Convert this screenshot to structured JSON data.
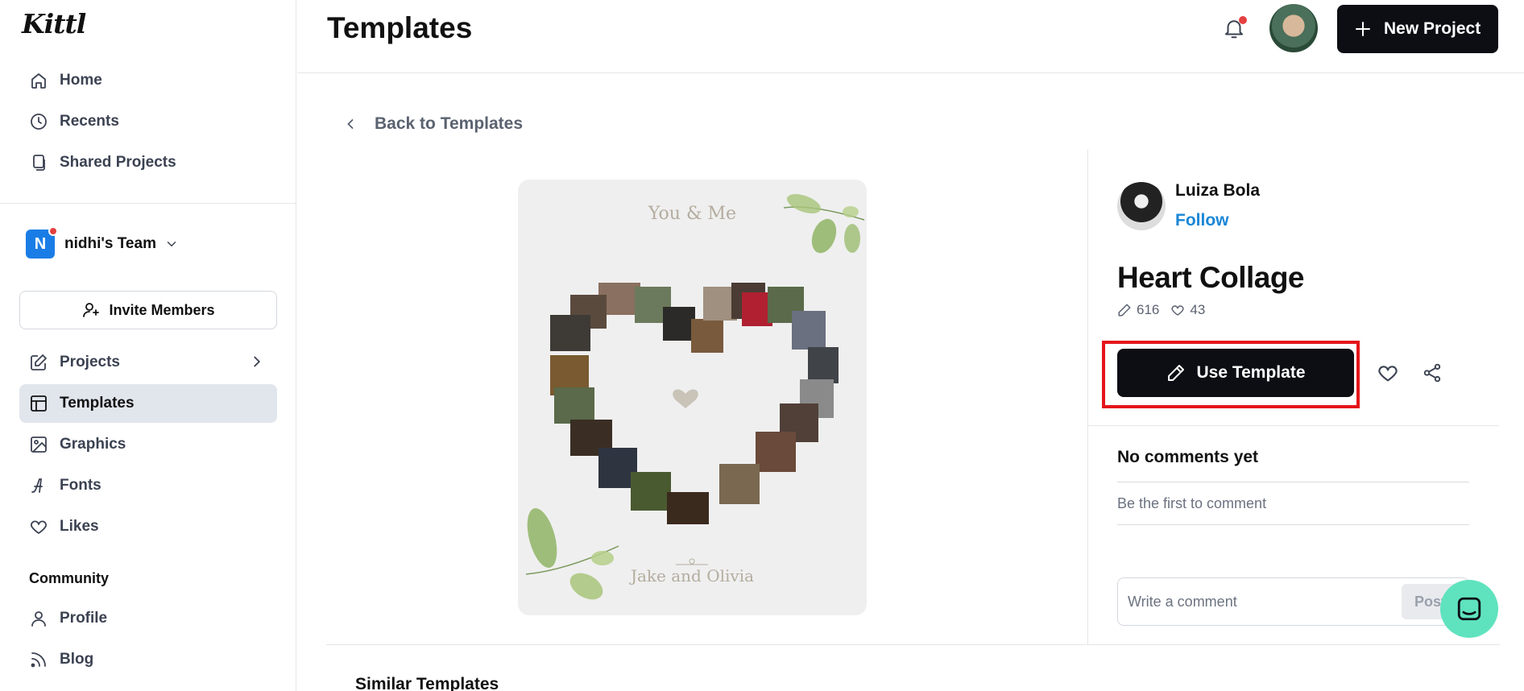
{
  "app": {
    "logo": "Kittl"
  },
  "sidebar": {
    "nav": [
      {
        "label": "Home",
        "icon": "home-icon"
      },
      {
        "label": "Recents",
        "icon": "clock-icon"
      },
      {
        "label": "Shared Projects",
        "icon": "shared-files-icon"
      }
    ],
    "team": {
      "initial": "N",
      "name": "nidhi's Team"
    },
    "invite_label": "Invite Members",
    "workspace": [
      {
        "label": "Projects",
        "icon": "pencil-square-icon"
      },
      {
        "label": "Templates",
        "icon": "layout-icon",
        "active": true
      },
      {
        "label": "Graphics",
        "icon": "image-icon"
      },
      {
        "label": "Fonts",
        "icon": "font-icon"
      },
      {
        "label": "Likes",
        "icon": "heart-icon"
      }
    ],
    "community_label": "Community",
    "community": [
      {
        "label": "Profile",
        "icon": "user-icon"
      },
      {
        "label": "Blog",
        "icon": "rss-icon"
      }
    ]
  },
  "header": {
    "title": "Templates",
    "new_project_label": "New Project"
  },
  "main": {
    "back_label": "Back to Templates",
    "preview": {
      "title": "You & Me",
      "names": "Jake and Olivia"
    },
    "similar_label": "Similar Templates"
  },
  "template": {
    "author": "Luiza Bola",
    "follow_label": "Follow",
    "title": "Heart Collage",
    "uses": "616",
    "likes": "43",
    "use_label": "Use Template"
  },
  "comments": {
    "empty_title": "No comments yet",
    "empty_subtitle": "Be the first to comment",
    "input_placeholder": "Write a comment",
    "post_label": "Post"
  },
  "colors": {
    "accent_dark": "#0c0e14",
    "link_blue": "#1a86d6",
    "highlight_red": "#e4151b",
    "chat_green": "#5fe3be"
  }
}
